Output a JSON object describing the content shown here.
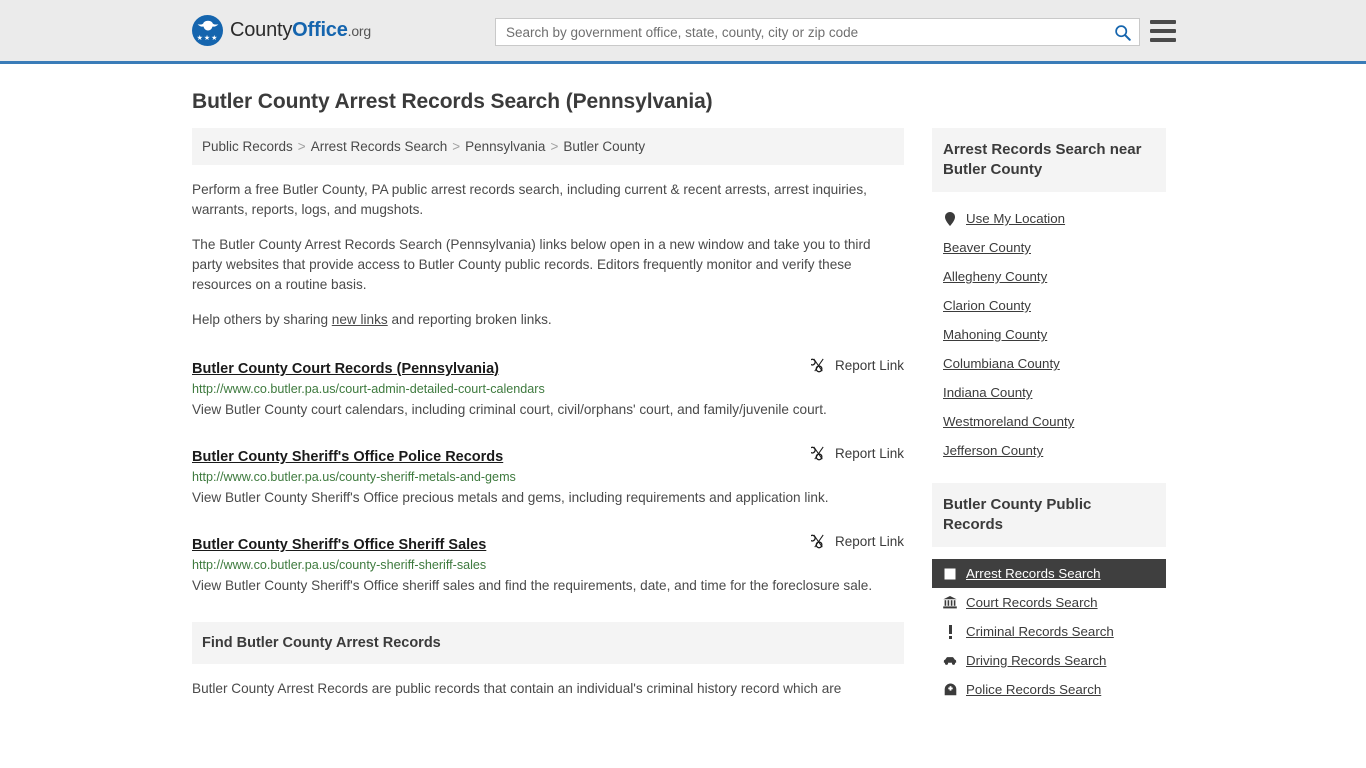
{
  "header": {
    "logo": {
      "part1": "County",
      "part2": "Office",
      "part3": ".org",
      "icon": "eagle-seal-logo",
      "stars": "★★★"
    },
    "search": {
      "placeholder": "Search by government office, state, county, city or zip code",
      "value": "",
      "icon": "search-icon"
    },
    "menu": {
      "icon": "hamburger-menu-icon"
    },
    "accent_color": "#3a7cb8",
    "background_color": "#ebebeb"
  },
  "page": {
    "title": "Butler County Arrest Records Search (Pennsylvania)"
  },
  "breadcrumb": {
    "items": [
      {
        "label": "Public Records"
      },
      {
        "label": "Arrest Records Search"
      },
      {
        "label": "Pennsylvania"
      },
      {
        "label": "Butler County"
      }
    ],
    "separator": ">"
  },
  "intro": {
    "paragraph1": "Perform a free Butler County, PA public arrest records search, including current & recent arrests, arrest inquiries, warrants, reports, logs, and mugshots.",
    "paragraph2": "The Butler County Arrest Records Search (Pennsylvania) links below open in a new window and take you to third party websites that provide access to Butler County public records. Editors frequently monitor and verify these resources on a routine basis.",
    "paragraph3_pre": "Help others by sharing ",
    "paragraph3_link": "new links",
    "paragraph3_post": " and reporting broken links."
  },
  "entries": [
    {
      "title": "Butler County Court Records (Pennsylvania)",
      "url": "http://www.co.butler.pa.us/court-admin-detailed-court-calendars",
      "description": "View Butler County court calendars, including criminal court, civil/orphans' court, and family/juvenile court.",
      "report_label": "Report Link",
      "report_icon": "broken-link-icon"
    },
    {
      "title": "Butler County Sheriff's Office Police Records",
      "url": "http://www.co.butler.pa.us/county-sheriff-metals-and-gems",
      "description": "View Butler County Sheriff's Office precious metals and gems, including requirements and application link.",
      "report_label": "Report Link",
      "report_icon": "broken-link-icon"
    },
    {
      "title": "Butler County Sheriff's Office Sheriff Sales",
      "url": "http://www.co.butler.pa.us/county-sheriff-sheriff-sales",
      "description": "View Butler County Sheriff's Office sheriff sales and find the requirements, date, and time for the foreclosure sale.",
      "report_label": "Report Link",
      "report_icon": "broken-link-icon"
    }
  ],
  "find_section": {
    "heading": "Find Butler County Arrest Records",
    "body": "Butler County Arrest Records are public records that contain an individual's criminal history record which are"
  },
  "sidebar": {
    "nearby": {
      "heading": "Arrest Records Search near Butler County",
      "use_my_location": {
        "label": "Use My Location",
        "icon": "location-pin-icon"
      },
      "counties": [
        {
          "label": "Beaver County"
        },
        {
          "label": "Allegheny County"
        },
        {
          "label": "Clarion County"
        },
        {
          "label": "Mahoning County"
        },
        {
          "label": "Columbiana County"
        },
        {
          "label": "Indiana County"
        },
        {
          "label": "Westmoreland County"
        },
        {
          "label": "Jefferson County"
        }
      ]
    },
    "public_records": {
      "heading": "Butler County Public Records",
      "active_background": "#3f3f3f",
      "items": [
        {
          "label": "Arrest Records Search",
          "icon": "fingerprint-card-icon",
          "active": true
        },
        {
          "label": "Court Records Search",
          "icon": "courthouse-icon",
          "active": false
        },
        {
          "label": "Criminal Records Search",
          "icon": "exclamation-icon",
          "active": false
        },
        {
          "label": "Driving Records Search",
          "icon": "car-icon",
          "active": false
        },
        {
          "label": "Police Records Search",
          "icon": "police-badge-icon",
          "active": false
        }
      ]
    }
  }
}
